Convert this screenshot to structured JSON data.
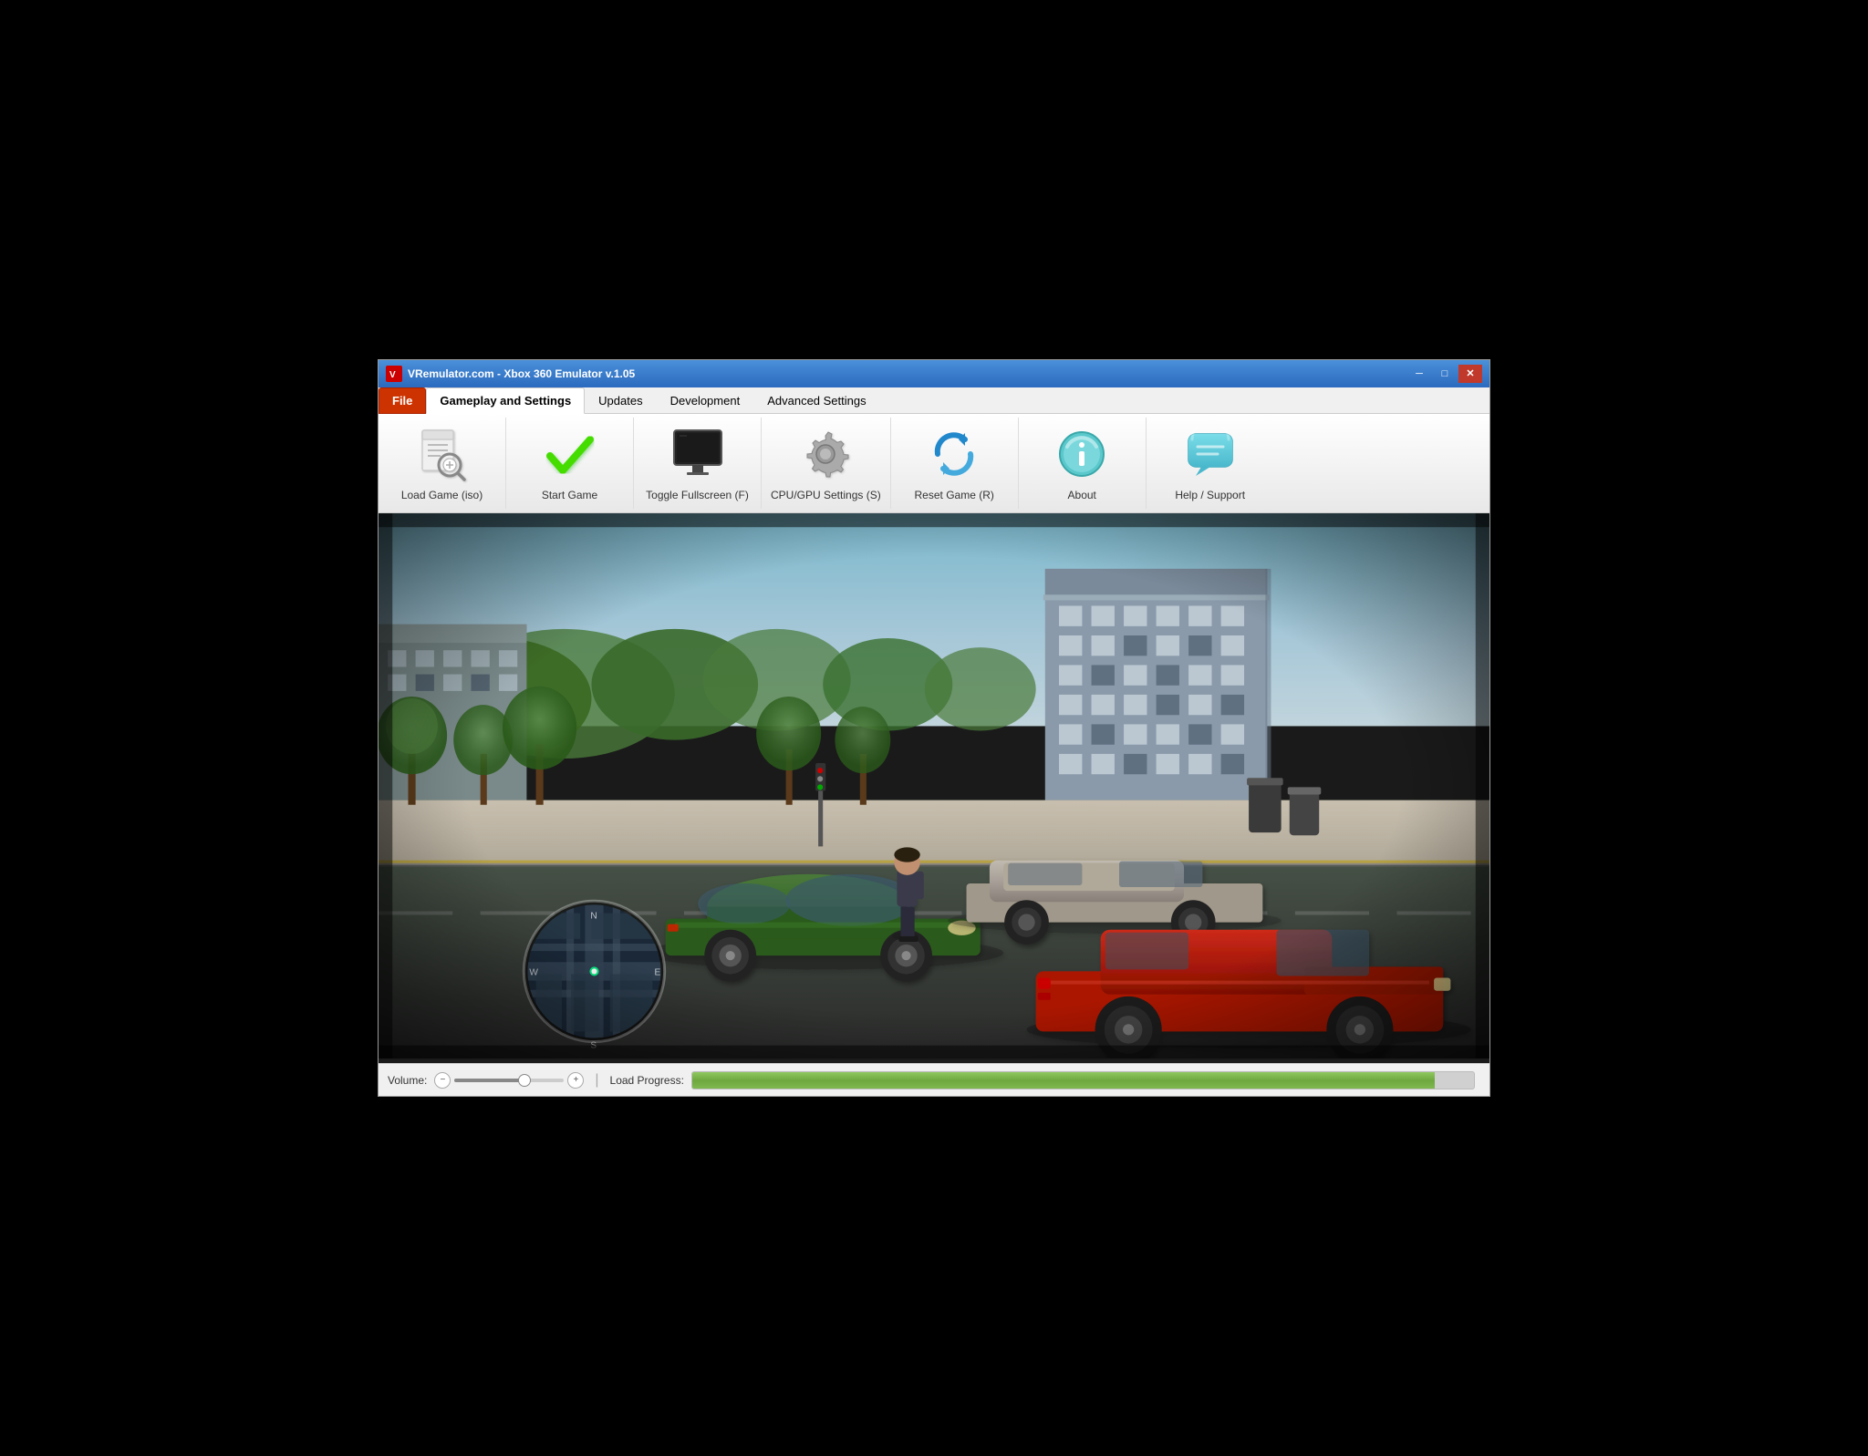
{
  "window": {
    "title": "VRemulator.com - Xbox 360 Emulator v.1.05",
    "icon": "V"
  },
  "titlebar": {
    "minimize_label": "─",
    "maximize_label": "□",
    "close_label": "✕"
  },
  "menu": {
    "tabs": [
      {
        "id": "file",
        "label": "File",
        "active": false,
        "special": true
      },
      {
        "id": "gameplay",
        "label": "Gameplay and Settings",
        "active": true,
        "special": false
      },
      {
        "id": "updates",
        "label": "Updates",
        "active": false,
        "special": false
      },
      {
        "id": "development",
        "label": "Development",
        "active": false,
        "special": false
      },
      {
        "id": "advanced",
        "label": "Advanced Settings",
        "active": false,
        "special": false
      }
    ]
  },
  "toolbar": {
    "buttons": [
      {
        "id": "load-game",
        "label": "Load Game (iso)",
        "icon": "document-search"
      },
      {
        "id": "start-game",
        "label": "Start Game",
        "icon": "checkmark"
      },
      {
        "id": "toggle-fullscreen",
        "label": "Toggle Fullscreen (F)",
        "icon": "monitor"
      },
      {
        "id": "cpu-gpu-settings",
        "label": "CPU/GPU Settings (S)",
        "icon": "gear"
      },
      {
        "id": "reset-game",
        "label": "Reset Game (R)",
        "icon": "refresh"
      },
      {
        "id": "about",
        "label": "About",
        "icon": "info"
      },
      {
        "id": "help-support",
        "label": "Help / Support",
        "icon": "chat"
      }
    ]
  },
  "statusbar": {
    "volume_label": "Volume:",
    "vol_minus": "−",
    "vol_plus": "+",
    "divider": "|",
    "progress_label": "Load Progress:",
    "progress_value": 95
  }
}
